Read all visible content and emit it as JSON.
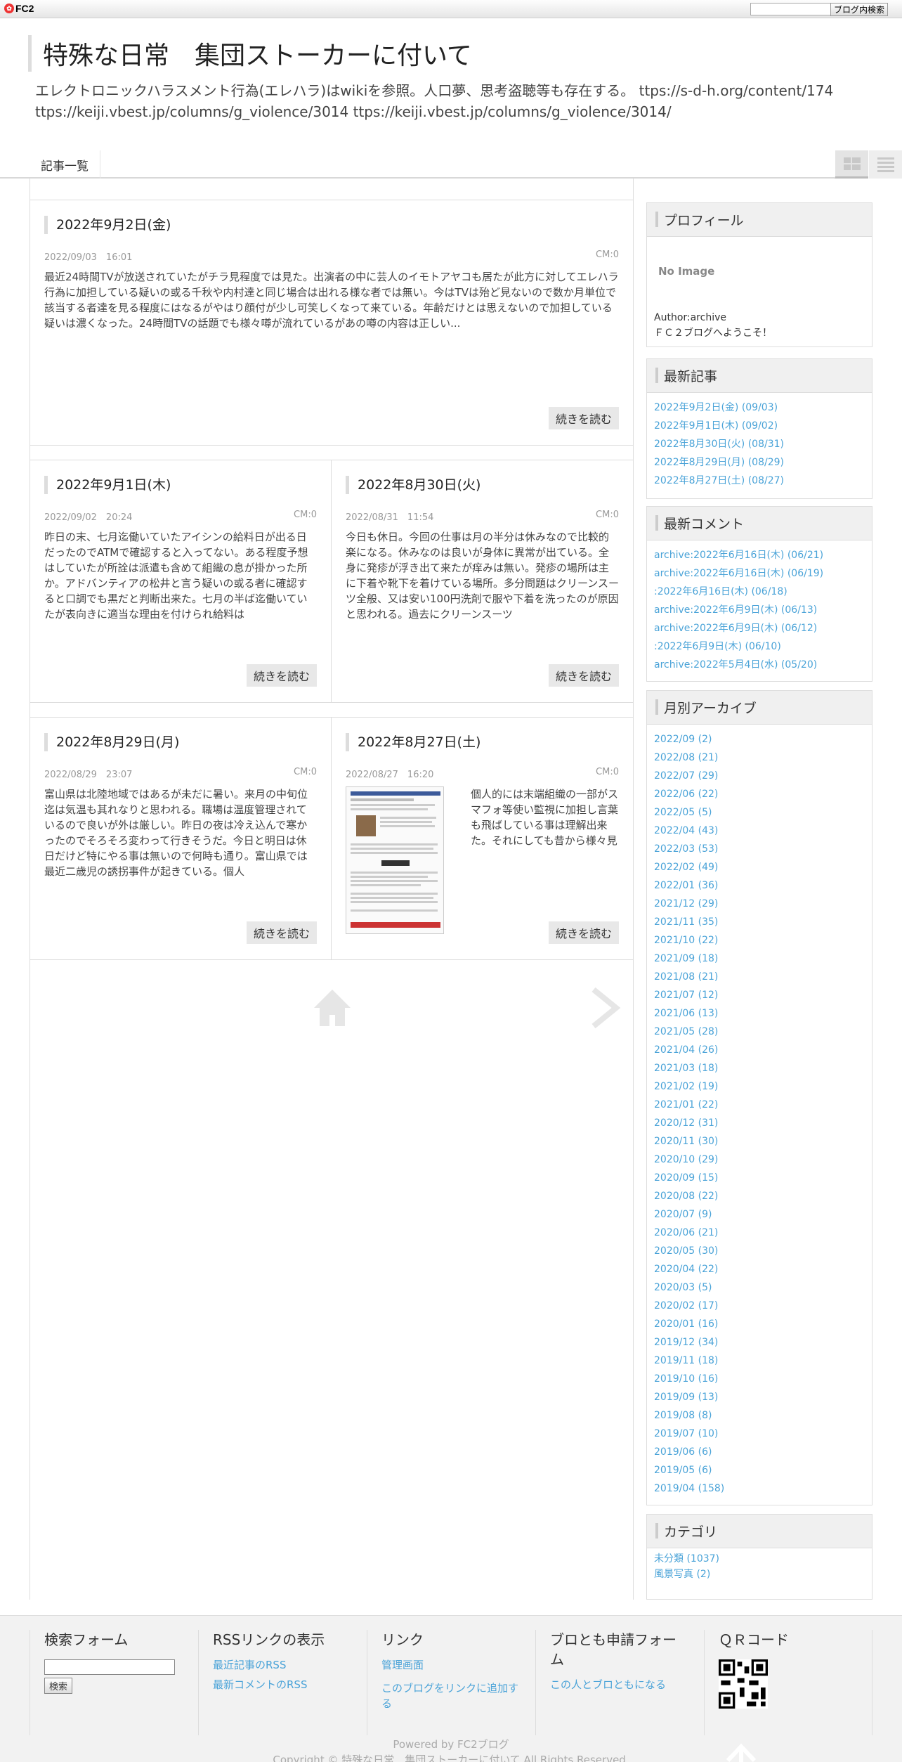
{
  "fc2bar": {
    "logo": "FC2",
    "search_button": "ブログ内検索",
    "search_placeholder": ""
  },
  "header": {
    "title": "特殊な日常　集団ストーカーに付いて",
    "description": "エレクトロニックハラスメント行為(エレハラ)はwikiを参照。人口夢、思考盗聴等も存在する。 ttps://s-d-h.org/content/174 ttps://keiji.vbest.jp/columns/g_violence/3014 ttps://keiji.vbest.jp/columns/g_violence/3014/"
  },
  "nav": {
    "tab_label": "記事一覧"
  },
  "articles": [
    {
      "title": "2022年9月2日(金)",
      "date": "2022/09/03　16:01",
      "cm": "CM:0",
      "body": "最近24時間TVが放送されていたがチラ見程度では見た。出演者の中に芸人のイモトアヤコも居たが此方に対してエレハラ行為に加担している疑いの或る千秋や内村達と同じ場合は出れる様な者では無い。今はTVは殆ど見ないので数か月単位で該当する者達を見る程度にはなるがやはり顔付が少し可笑しくなって来ている。年齢だけとは思えないので加担している疑いは濃くなった。24時間TVの話題でも様々噂が流れているがあの噂の内容は正しい...",
      "more": "続きを読む"
    },
    {
      "title": "2022年9月1日(木)",
      "date": "2022/09/02　20:24",
      "cm": "CM:0",
      "body": "昨日の末、七月迄働いていたアイシンの給料日が出る日だったのでATMで確認すると入ってない。ある程度予想はしていたが所詮は派遣も含めて組織の息が掛かった所か。アドバンティアの松井と言う疑いの或る者に確認すると口調でも黒だと判断出来た。七月の半ば迄働いていたが表向きに適当な理由を付けられ給料は",
      "more": "続きを読む"
    },
    {
      "title": "2022年8月30日(火)",
      "date": "2022/08/31　11:54",
      "cm": "CM:0",
      "body": "今日も休日。今回の仕事は月の半分は休みなので比較的楽になる。休みなのは良いが身体に異常が出ている。全身に発疹が浮き出て来たが痒みは無い。発疹の場所は主に下着や靴下を着けている場所。多分問題はクリーンスーツ全般、又は安い100円洗剤で服や下着を洗ったのが原因と思われる。過去にクリーンスーツ",
      "more": "続きを読む"
    },
    {
      "title": "2022年8月29日(月)",
      "date": "2022/08/29　23:07",
      "cm": "CM:0",
      "body": "富山県は北陸地域ではあるが未だに暑い。来月の中旬位迄は気温も其れなりと思われる。職場は温度管理されているので良いが外は厳しい。昨日の夜は冷え込んで寒かったのでそろそろ変わって行きそうだ。今日と明日は休日だけど特にやる事は無いので何時も通り。富山県では最近二歳児の誘拐事件が起きている。個人",
      "more": "続きを読む"
    },
    {
      "title": "2022年8月27日(土)",
      "date": "2022/08/27　16:20",
      "cm": "CM:0",
      "body": "個人的には末端組織の一部がスマフォ等使い監視に加担し言葉も飛ばしている事は理解出来た。それにしても昔から様々見て来たが人としても大した事無い、あの程度の者達",
      "more": "続きを読む"
    }
  ],
  "sidebar": {
    "profile": {
      "heading": "プロフィール",
      "no_image": "No Image",
      "author": "Author:archive",
      "welcome": "ＦＣ２ブログへようこそ！"
    },
    "recent_posts": {
      "heading": "最新記事",
      "items": [
        "2022年9月2日(金) (09/03)",
        "2022年9月1日(木) (09/02)",
        "2022年8月30日(火) (08/31)",
        "2022年8月29日(月) (08/29)",
        "2022年8月27日(土) (08/27)"
      ]
    },
    "recent_comments": {
      "heading": "最新コメント",
      "items": [
        "archive:2022年6月16日(木) (06/21)",
        "archive:2022年6月16日(木) (06/19)",
        ":2022年6月16日(木) (06/18)",
        "archive:2022年6月9日(木) (06/13)",
        "archive:2022年6月9日(木) (06/12)",
        ":2022年6月9日(木) (06/10)",
        "archive:2022年5月4日(水) (05/20)"
      ]
    },
    "monthly": {
      "heading": "月別アーカイブ",
      "items": [
        "2022/09 (2)",
        "2022/08 (21)",
        "2022/07 (29)",
        "2022/06 (22)",
        "2022/05 (5)",
        "2022/04 (43)",
        "2022/03 (53)",
        "2022/02 (49)",
        "2022/01 (36)",
        "2021/12 (29)",
        "2021/11 (35)",
        "2021/10 (22)",
        "2021/09 (18)",
        "2021/08 (21)",
        "2021/07 (12)",
        "2021/06 (13)",
        "2021/05 (28)",
        "2021/04 (26)",
        "2021/03 (18)",
        "2021/02 (19)",
        "2021/01 (22)",
        "2020/12 (31)",
        "2020/11 (30)",
        "2020/10 (29)",
        "2020/09 (15)",
        "2020/08 (22)",
        "2020/07 (9)",
        "2020/06 (21)",
        "2020/05 (30)",
        "2020/04 (22)",
        "2020/03 (5)",
        "2020/02 (17)",
        "2020/01 (16)",
        "2019/12 (34)",
        "2019/11 (18)",
        "2019/10 (16)",
        "2019/09 (13)",
        "2019/08 (8)",
        "2019/07 (10)",
        "2019/06 (6)",
        "2019/05 (6)",
        "2019/04 (158)"
      ]
    },
    "category": {
      "heading": "カテゴリ",
      "items": [
        "未分類 (1037)",
        "風景写真 (2)"
      ]
    }
  },
  "footer": {
    "search": {
      "heading": "検索フォーム",
      "button": "検索"
    },
    "rss": {
      "heading": "RSSリンクの表示",
      "links": [
        "最近記事のRSS",
        "最新コメントのRSS"
      ]
    },
    "links": {
      "heading": "リンク",
      "links": [
        "管理画面",
        "このブログをリンクに追加する"
      ]
    },
    "friend": {
      "heading": "ブロとも申請フォーム",
      "link": "この人とブロともになる"
    },
    "qr": {
      "heading": "ＱＲコード"
    },
    "powered": "Powered by FC2ブログ",
    "copyright": "Copyright © 特殊な日常　集団ストーカーに付いて All Rights Reserved."
  }
}
